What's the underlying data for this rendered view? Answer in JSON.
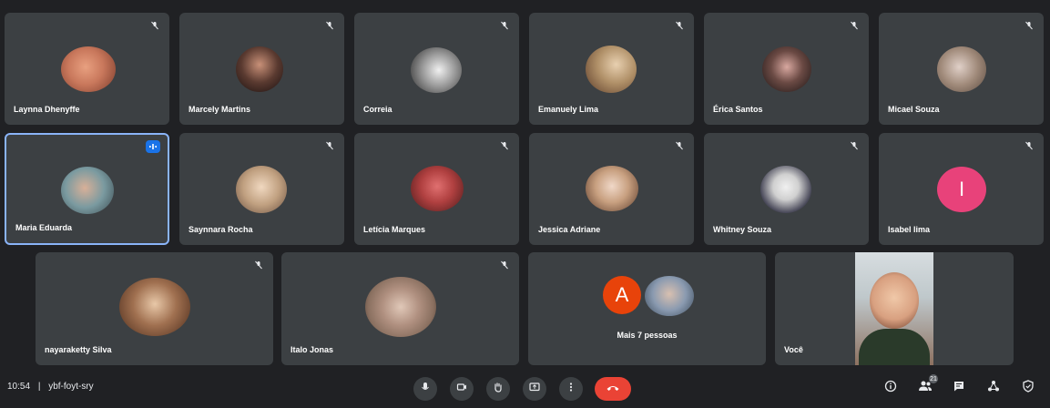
{
  "participants": [
    {
      "name": "Laynna Dhenyffe",
      "avatar_color": "#c9785c"
    },
    {
      "name": "Marcely Martins",
      "avatar_color": "#5a3a30"
    },
    {
      "name": "Correia",
      "avatar_color": "#9a9a9a"
    },
    {
      "name": "Emanuely Lima",
      "avatar_color": "#b09068"
    },
    {
      "name": "Érica Santos",
      "avatar_color": "#6b4a44"
    },
    {
      "name": "Micael Souza",
      "avatar_color": "#a08a7a"
    },
    {
      "name": "Maria Eduarda",
      "avatar_color": "#7a9aa0",
      "speaking": true
    },
    {
      "name": "Saynnara Rocha",
      "avatar_color": "#c0a080"
    },
    {
      "name": "Letícia Marques",
      "avatar_color": "#b04040"
    },
    {
      "name": "Jessica Adriane",
      "avatar_color": "#c8a080"
    },
    {
      "name": "Whitney Souza",
      "avatar_color": "#4a4a5a"
    },
    {
      "name": "Isabel lima",
      "initial": "I",
      "avatar_color": "#e8427a"
    },
    {
      "name": "nayaraketty Silva",
      "avatar_color": "#a07050"
    },
    {
      "name": "Italo Jonas",
      "avatar_color": "#8a7060"
    },
    {
      "name": "Mais 7 pessoas",
      "initial": "A",
      "avatar_color": "#e8430a",
      "group": true
    },
    {
      "name": "Você",
      "self": true
    }
  ],
  "footer": {
    "time": "10:54",
    "separator": "|",
    "meeting_code": "ybf-foyt-sry",
    "participant_count": "21"
  },
  "colors": {
    "background": "#202124",
    "tile": "#3c4043",
    "active_border": "#8ab4f8",
    "end_call": "#ea4335"
  }
}
